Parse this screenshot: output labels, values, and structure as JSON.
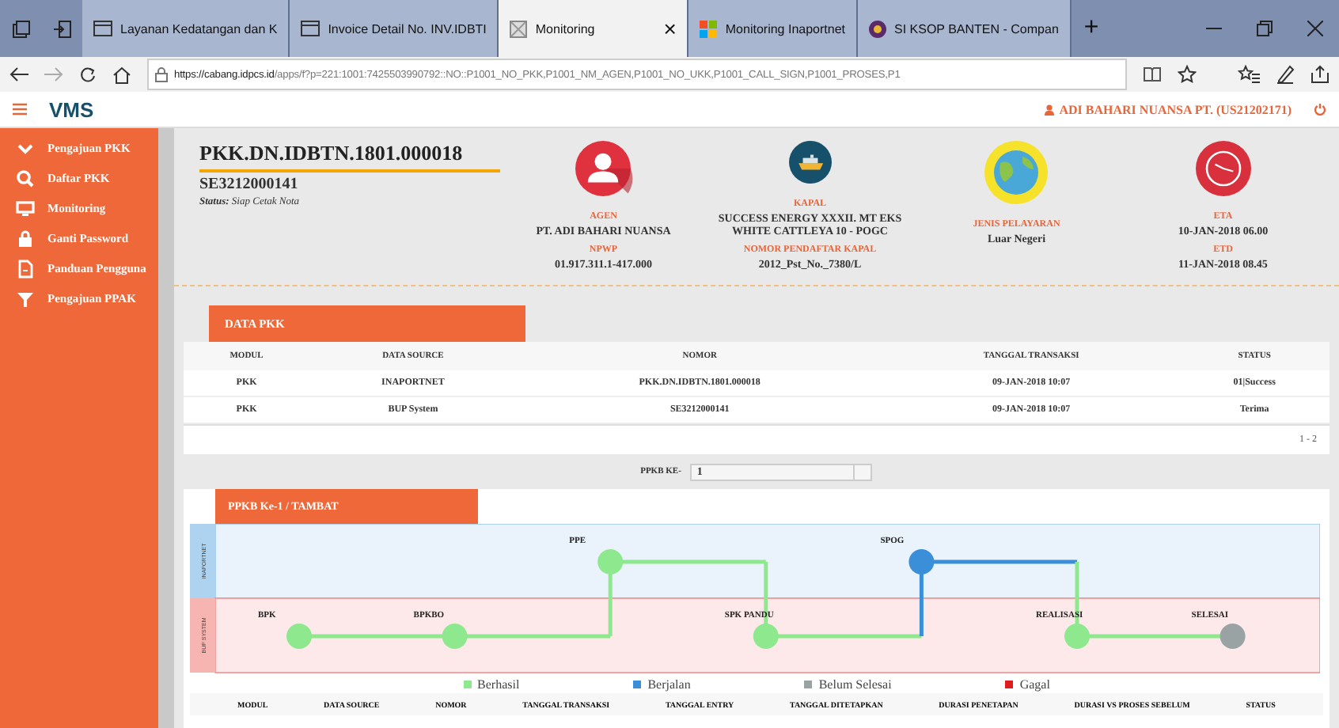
{
  "browser": {
    "tabs": [
      {
        "label": "Layanan Kedatangan dan K",
        "kind": "page",
        "selected": false
      },
      {
        "label": "Invoice Detail No. INV.IDBTI",
        "kind": "page",
        "selected": false
      },
      {
        "label": "Monitoring",
        "kind": "blank",
        "selected": true,
        "close": "×"
      },
      {
        "label": "Monitoring Inaportnet",
        "kind": "tiles",
        "selected": false
      },
      {
        "label": "SI KSOP BANTEN - Compan",
        "kind": "emblem",
        "selected": false
      }
    ],
    "new_tab": "+",
    "url_host": "https://cabang.idpcs.id",
    "url_rest": "/apps/f?p=221:1001:7425503990792::NO::P1001_NO_PKK,P1001_NM_AGEN,P1001_NO_UKK,P1001_CALL_SIGN,P1001_PROSES,P1"
  },
  "header": {
    "brand": "VMS",
    "user": "ADI BAHARI NUANSA PT. (US21202171)"
  },
  "sidebar": {
    "items": [
      {
        "label": "Pengajuan PKK",
        "kind": "chevron"
      },
      {
        "label": "Daftar PKK",
        "kind": "search"
      },
      {
        "label": "Monitoring",
        "kind": "monitor"
      },
      {
        "label": "Ganti Password",
        "kind": "lock"
      },
      {
        "label": "Panduan Pengguna",
        "kind": "file"
      },
      {
        "label": "Pengajuan PPAK",
        "kind": "filter"
      }
    ]
  },
  "summary": {
    "title": "PKK.DN.IDBTN.1801.000018",
    "subtitle": "SE3212000141",
    "status_label": "Status:",
    "status_value": "Siap Cetak Nota",
    "items": [
      {
        "kind": "agent",
        "fields": [
          {
            "label": "AGEN",
            "value": "PT. ADI BAHARI NUANSA"
          },
          {
            "label": "NPWP",
            "value": "01.917.311.1-417.000"
          }
        ]
      },
      {
        "kind": "ship",
        "fields": [
          {
            "label": "KAPAL",
            "value": "SUCCESS ENERGY XXXII. MT EKS WHITE CATTLEYA 10 - POGC"
          },
          {
            "label": "NOMOR PENDAFTAR KAPAL",
            "value": "2012_Pst_No._7380/L"
          }
        ]
      },
      {
        "kind": "globe",
        "fields": [
          {
            "label": "JENIS PELAYARAN",
            "value": "Luar Negeri"
          }
        ]
      },
      {
        "kind": "clock",
        "fields": [
          {
            "label": "ETA",
            "value": "10-JAN-2018 06.00"
          },
          {
            "label": "ETD",
            "value": "11-JAN-2018 08.45"
          }
        ]
      }
    ]
  },
  "data_pkk": {
    "title": "DATA PKK",
    "columns": [
      "MODUL",
      "DATA SOURCE",
      "NOMOR",
      "TANGGAL TRANSAKSI",
      "STATUS"
    ],
    "rows": [
      [
        "PKK",
        "INAPORTNET",
        "PKK.DN.IDBTN.1801.000018",
        "09-JAN-2018 10:07",
        "01|Success"
      ],
      [
        "PKK",
        "BUP System",
        "SE3212000141",
        "09-JAN-2018 10:07",
        "Terima"
      ]
    ],
    "pagination": "1 - 2"
  },
  "ppkb_select": {
    "label": "PPKB KE-",
    "value": "1"
  },
  "flow": {
    "title": "PPKB Ke-1 / TAMBAT",
    "lanes": [
      "INAPORTNET",
      "BUP SYSTEM"
    ],
    "nodes": [
      {
        "label": "BPK",
        "kind": "lower",
        "color": "#8ee88e"
      },
      {
        "label": "BPKBO",
        "kind": "lower",
        "color": "#8ee88e"
      },
      {
        "label": "PPE",
        "kind": "upper",
        "color": "#8ee88e"
      },
      {
        "label": "SPK PANDU",
        "kind": "lower",
        "color": "#8ee88e"
      },
      {
        "label": "SPOG",
        "kind": "upper",
        "color": "#3b8fd9"
      },
      {
        "label": "REALISASI",
        "kind": "lower",
        "color": "#8ee88e"
      },
      {
        "label": "SELESAI",
        "kind": "lower",
        "color": "#9aa3a3"
      }
    ],
    "legend": [
      {
        "label": "Berhasil",
        "color": "#8ee88e"
      },
      {
        "label": "Berjalan",
        "color": "#3b8fd9"
      },
      {
        "label": "Belum Selesai",
        "color": "#9aa3a3"
      },
      {
        "label": "Gagal",
        "color": "#e01b1b"
      }
    ],
    "columns": [
      "MODUL",
      "DATA SOURCE",
      "NOMOR",
      "TANGGAL TRANSAKSI",
      "TANGGAL ENTRY",
      "TANGGAL DITETAPKAN",
      "DURASI PENETAPAN",
      "DURASI VS PROSES SEBELUM",
      "STATUS"
    ]
  }
}
